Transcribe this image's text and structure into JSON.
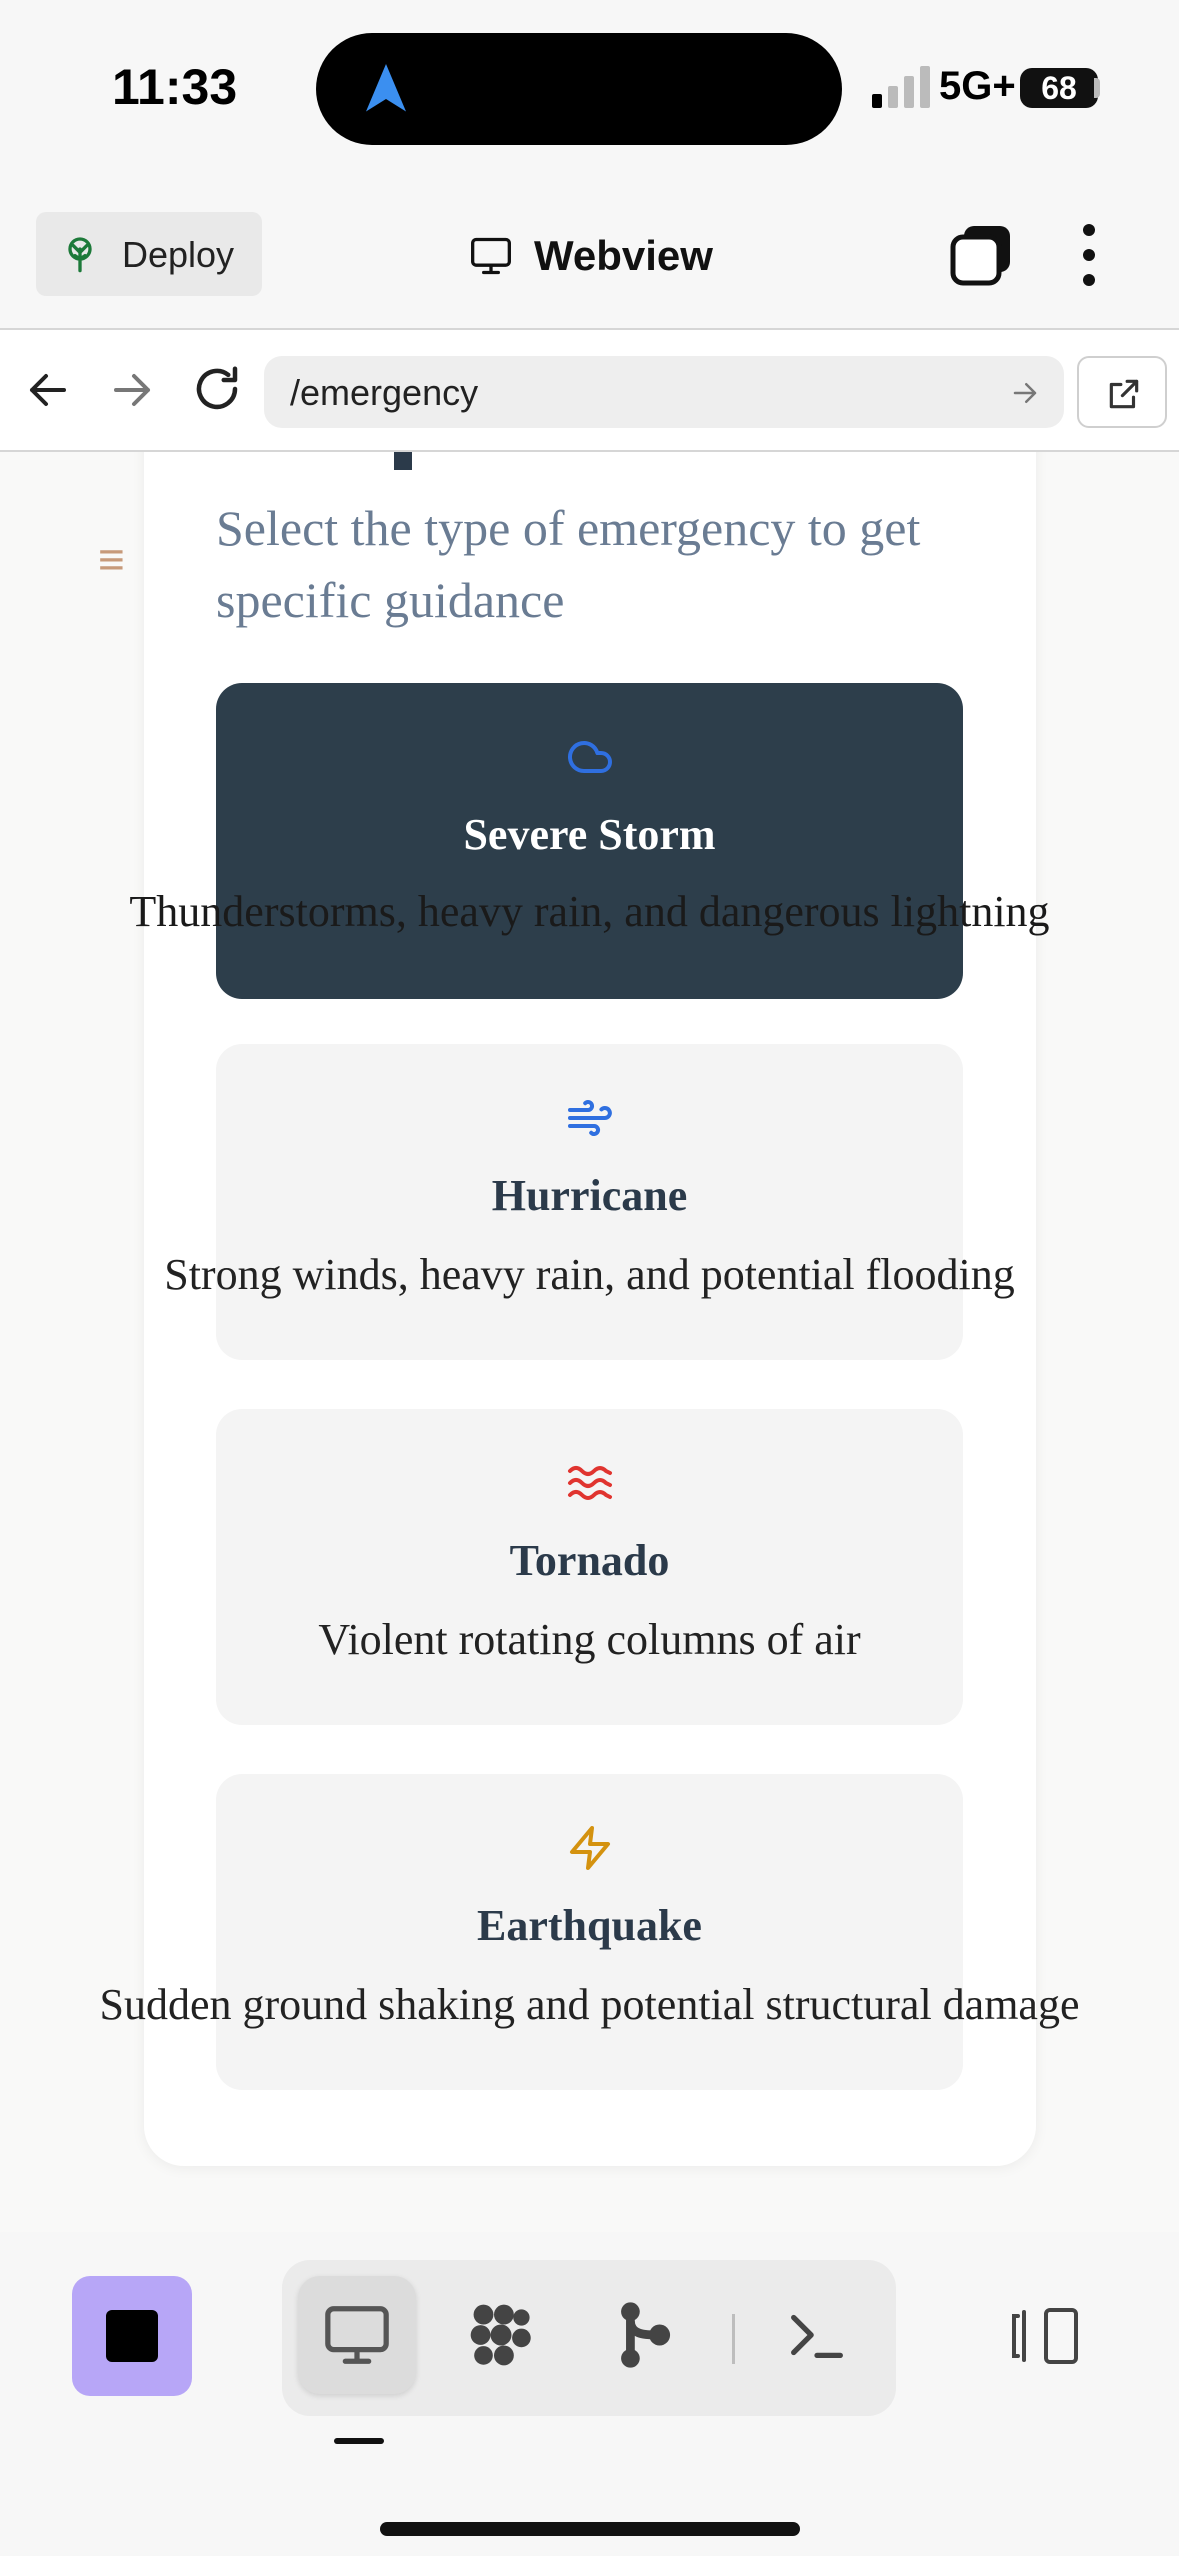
{
  "status_bar": {
    "time": "11:33",
    "network": "5G+",
    "battery": "68"
  },
  "app_bar": {
    "deploy_label": "Deploy",
    "title": "Webview"
  },
  "url_bar": {
    "path": "/emergency"
  },
  "page": {
    "subtitle": "Select the type of emergency to get specific guidance",
    "options": [
      {
        "title": "Severe Storm",
        "description": "Thunderstorms, heavy rain, and dangerous lightning",
        "icon": "cloud-icon",
        "icon_color": "#2f6fe0",
        "selected": true
      },
      {
        "title": "Hurricane",
        "description": "Strong winds, heavy rain, and potential flooding",
        "icon": "wind-icon",
        "icon_color": "#2f6fe0",
        "selected": false
      },
      {
        "title": "Tornado",
        "description": "Violent rotating columns of air",
        "icon": "waves-icon",
        "icon_color": "#e0342f",
        "selected": false
      },
      {
        "title": "Earthquake",
        "description": "Sudden ground shaking and potential structural damage",
        "icon": "zap-icon",
        "icon_color": "#d4920f",
        "selected": false
      }
    ]
  },
  "colors": {
    "selected_card": "#2d3e4b",
    "stop_button": "#b7a6f7",
    "subtitle": "#6a7c93",
    "menu_icon": "#c79a7a"
  }
}
